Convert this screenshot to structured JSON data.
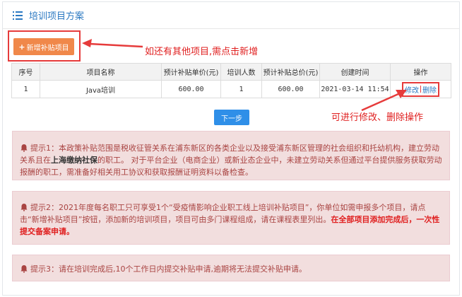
{
  "header": {
    "title": "培训项目方案",
    "icon": "list-icon"
  },
  "add_button": {
    "label": "新增补贴项目",
    "plus": "+"
  },
  "annotations": {
    "add_note": "如还有其他项目,需点击新增",
    "ops_note": "可进行修改、删除操作",
    "highlight_color": "#e02020"
  },
  "table": {
    "columns": [
      "序号",
      "项目名称",
      "预计补贴单价(元)",
      "培训人数",
      "预计补贴总价(元)",
      "创建时间",
      "操作"
    ],
    "rows": [
      {
        "index": "1",
        "name": "Java培训",
        "unit_price": "600.00",
        "count": "1",
        "total": "600.00",
        "created": "2021-03-14 11:54",
        "edit": "修改",
        "delete": "删除"
      }
    ]
  },
  "next_button": {
    "label": "下一步"
  },
  "tips": {
    "tip1": {
      "p1": "提示1：本政策补贴范围是税收征管关系在浦东新区的各类企业以及接受浦东新区管理的社会组织和托幼机构，建立劳动关系且在",
      "bold": "上海缴纳社保",
      "p2": "的职工。 对于平台企业（电商企业）或新业态企业中，未建立劳动关系但通过平台提供服务获取劳动报酬的职工，需准备好相关用工协议和获取报酬证明资料以备检查。"
    },
    "tip2": {
      "p1": "提示2：2021年度每名职工只可享受1个“受疫情影响企业职工线上培训补贴项目”，你单位如需申报多个项目，请点击“新增补贴项目”按钮，添加新的培训项目，项目可由多门课程组成，请在课程表里列出。",
      "bold_red": "在全部项目添加完成后，一次性提交备案申请。"
    },
    "tip3": {
      "text": "提示3：请在培训完成后,10个工作日内提交补贴申请,逾期将无法提交补贴申请。"
    }
  }
}
